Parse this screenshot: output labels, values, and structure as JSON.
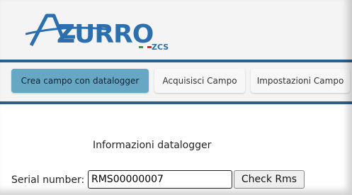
{
  "header": {
    "logo": {
      "name": "azzurro-zcs-logo",
      "text_main": "AZZURRO",
      "text_sub": "ZCS"
    }
  },
  "nav": {
    "tabs": [
      {
        "label": "Crea campo con datalogger",
        "active": true
      },
      {
        "label": "Acquisisci Campo",
        "active": false
      },
      {
        "label": "Impostazioni Campo",
        "active": false
      }
    ]
  },
  "datalogger": {
    "title": "Informazioni datalogger",
    "serial_label": "Serial number:",
    "serial_value": "RMS00000007",
    "check_label": "Check Rms"
  },
  "colors": {
    "brand_blue": "#2c5f8a",
    "active_tab": "#66a8c4"
  }
}
